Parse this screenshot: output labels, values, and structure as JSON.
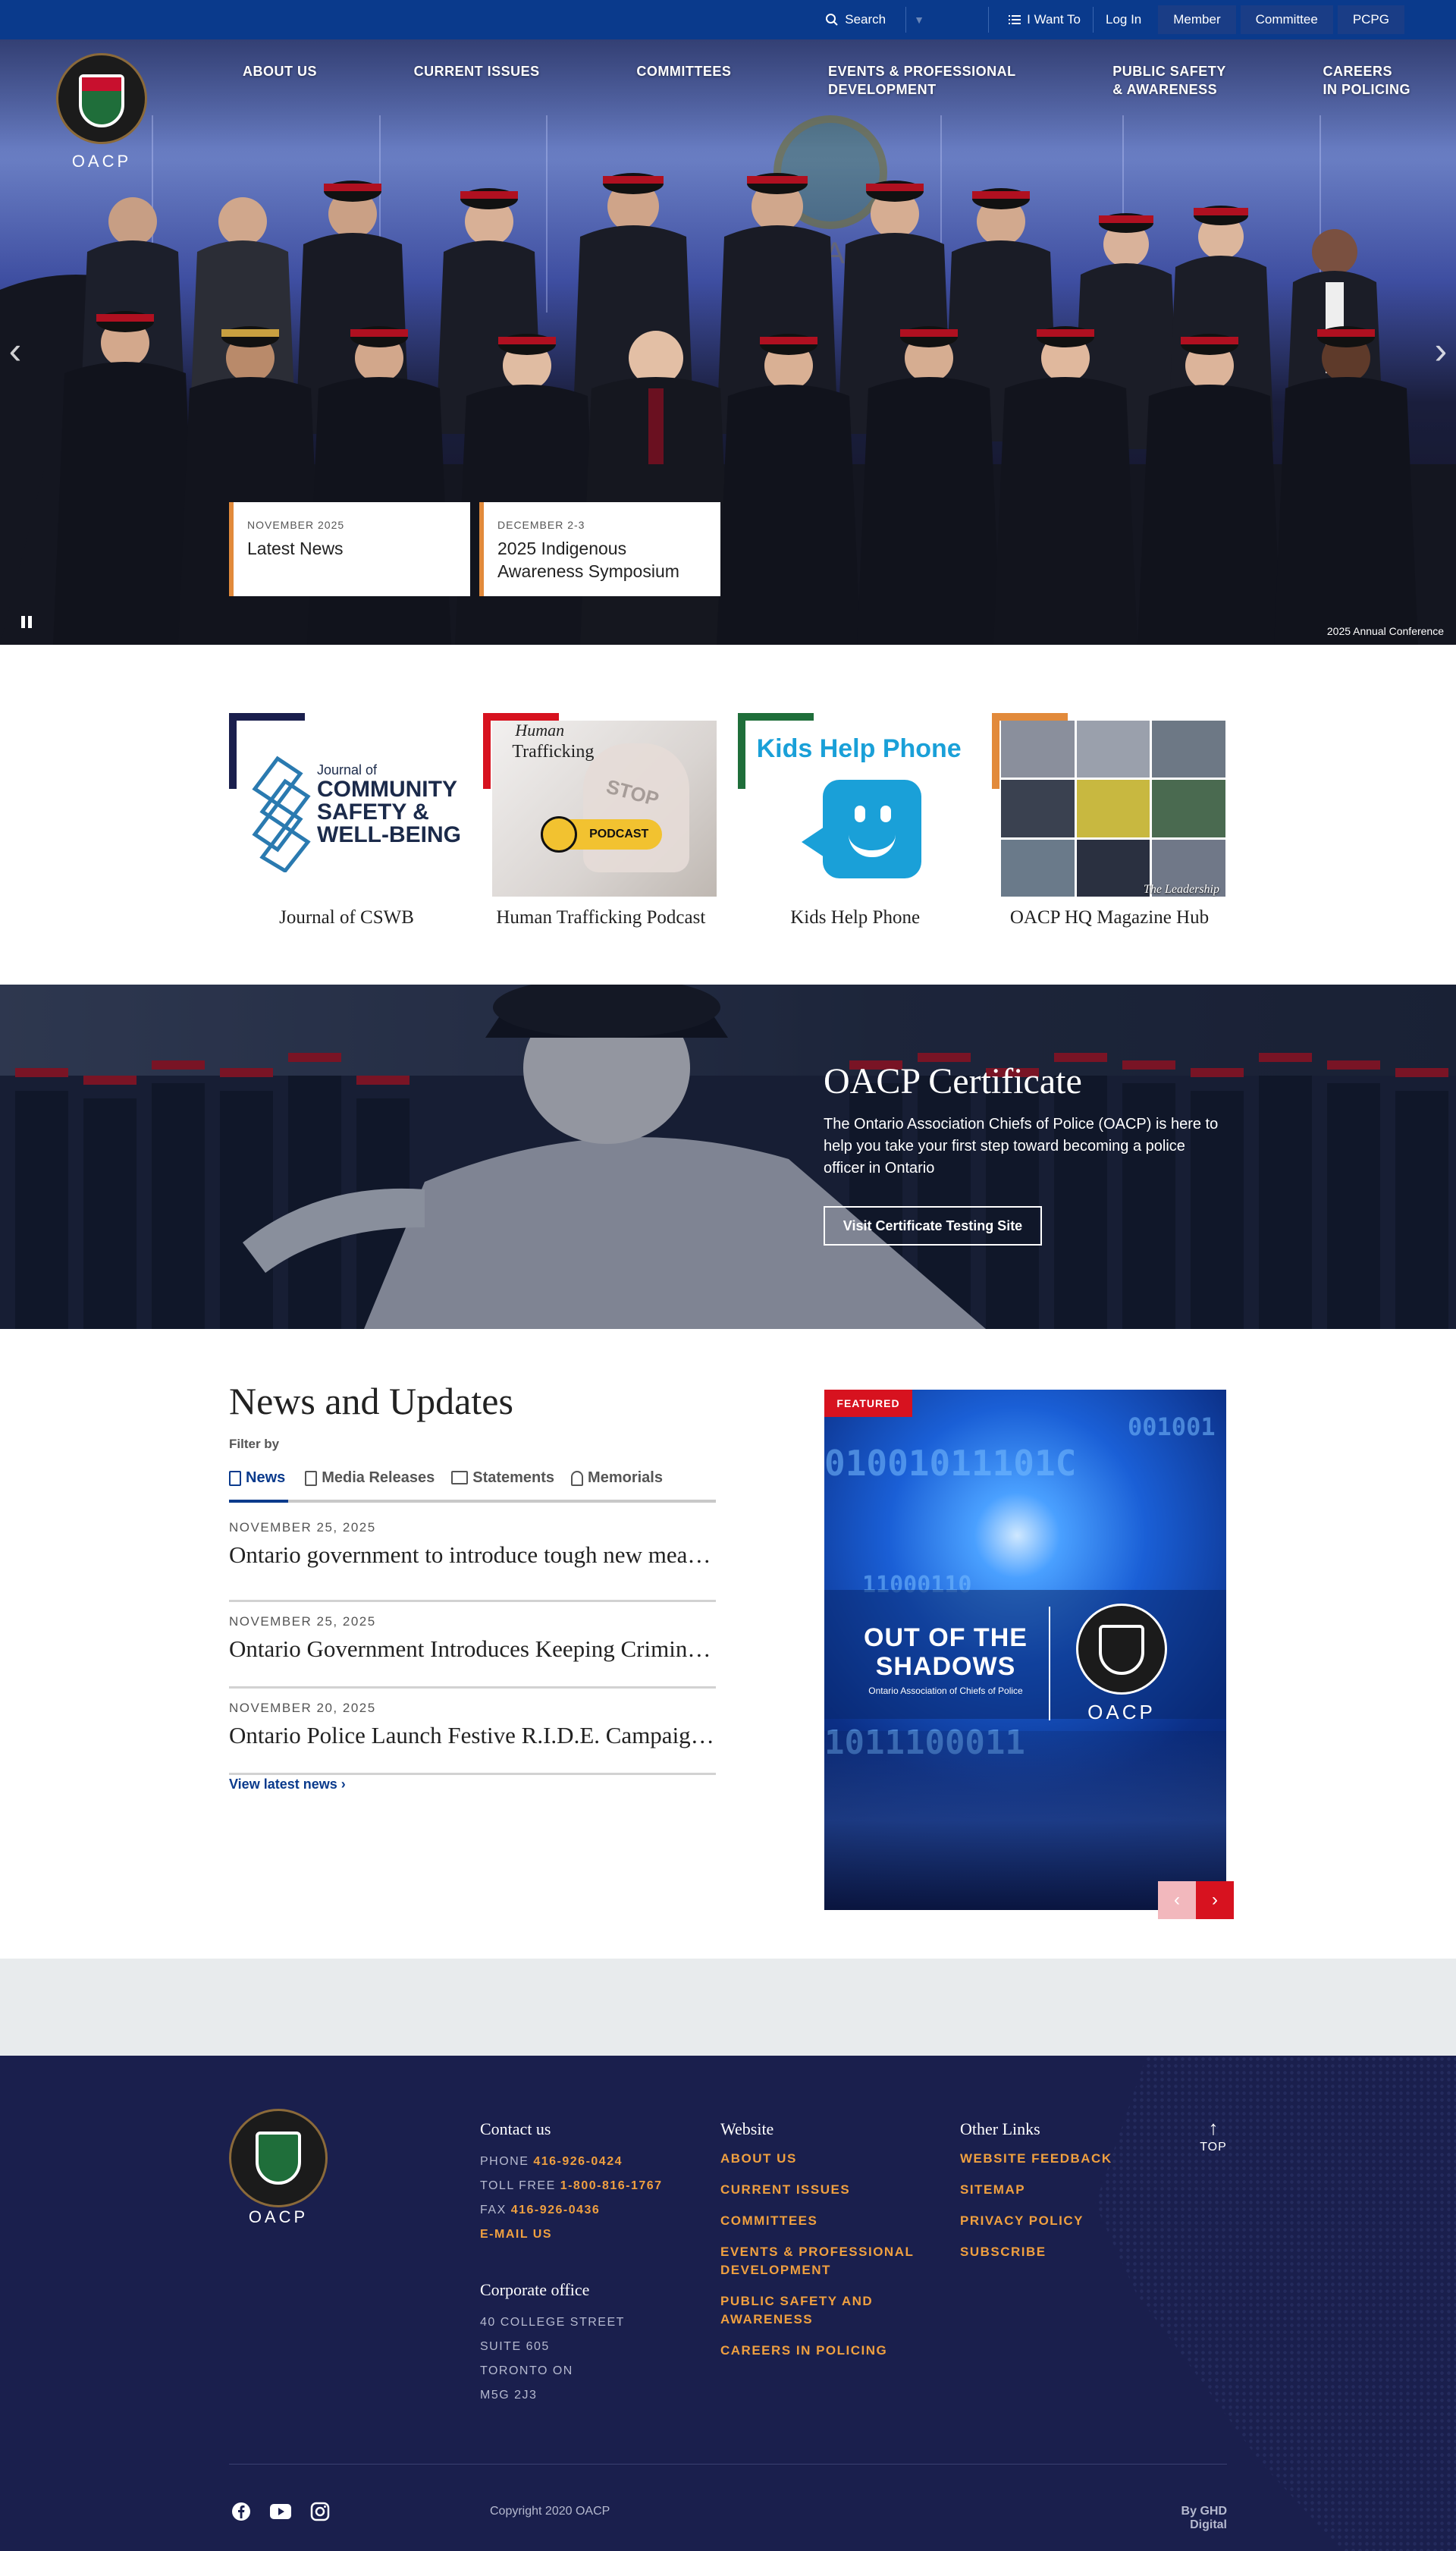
{
  "topbar": {
    "search_label": "Search",
    "language_value": "",
    "i_want_to_label": "I Want To",
    "login_label": "Log In",
    "buttons": [
      "Member",
      "Committee",
      "PCPG"
    ]
  },
  "logo": {
    "text": "OACP"
  },
  "nav": {
    "items": [
      "ABOUT US",
      "CURRENT ISSUES",
      "COMMITTEES",
      "EVENTS & PROFESSIONAL\nDEVELOPMENT",
      "PUBLIC SAFETY\n& AWARENESS",
      "CAREERS\nIN POLICING"
    ]
  },
  "hero": {
    "cards": [
      {
        "date": "NOVEMBER 2025",
        "title": "Latest News"
      },
      {
        "date": "DECEMBER 2-3",
        "title": "2025 Indigenous Awareness Symposium"
      }
    ],
    "caption": "2025 Annual Conference",
    "bg_text": "OACP"
  },
  "tiles": [
    {
      "caption": "Journal of CSWB",
      "accent": "#1a1f4d",
      "line1": "Journal of",
      "line2": "COMMUNITY",
      "line3": "SAFETY &",
      "line4": "WELL-BEING"
    },
    {
      "caption": "Human Trafficking Podcast",
      "accent": "#d7121f",
      "label1": "Human",
      "label2": "Trafficking",
      "pill": "PODCAST",
      "stop": "STOP"
    },
    {
      "caption": "Kids Help Phone",
      "accent": "#1f6e3a",
      "title": "Kids Help Phone"
    },
    {
      "caption": "OACP HQ Magazine Hub",
      "accent": "#e28a3b",
      "cover": "The Leadership"
    }
  ],
  "certificate": {
    "title": "OACP Certificate",
    "body": "The Ontario Association Chiefs of Police (OACP) is here to help you take your first step toward becoming a police officer in Ontario",
    "button": "Visit Certificate Testing Site"
  },
  "news": {
    "title": "News and Updates",
    "filter_label": "Filter by",
    "tabs": [
      "News",
      "Media Releases",
      "Statements",
      "Memorials"
    ],
    "items": [
      {
        "date": "NOVEMBER 25, 2025",
        "title": "Ontario government to introduce tough new measures to protect..."
      },
      {
        "date": "NOVEMBER 25, 2025",
        "title": "Ontario Government Introduces Keeping Criminals Behind Bars..."
      },
      {
        "date": "NOVEMBER 20, 2025",
        "title": "Ontario Police Launch Festive R.I.D.E. Campaign..."
      }
    ],
    "view_latest": "View latest news"
  },
  "featured": {
    "badge": "FEATURED",
    "headline": "OUT OF THE SHADOWS",
    "subline": "Ontario Association of Chiefs of Police",
    "logo_text": "OACP",
    "binary1": "01001011101C",
    "binary2": "001001",
    "binary3": "11000110",
    "binary4": "1011100011"
  },
  "footer": {
    "logo_text": "OACP",
    "contact": {
      "heading": "Contact us",
      "phone_label": "PHONE",
      "phone": "416-926-0424",
      "tollfree_label": "TOLL FREE",
      "tollfree": "1-800-816-1767",
      "fax_label": "FAX",
      "fax": "416-926-0436",
      "email": "E-MAIL US"
    },
    "office": {
      "heading": "Corporate office",
      "lines": [
        "40 COLLEGE STREET",
        "SUITE 605",
        "TORONTO ON",
        "M5G 2J3"
      ]
    },
    "website": {
      "heading": "Website",
      "links": [
        "ABOUT US",
        "CURRENT ISSUES",
        "COMMITTEES",
        "EVENTS & PROFESSIONAL\nDEVELOPMENT",
        "PUBLIC SAFETY AND\nAWARENESS",
        "CAREERS IN POLICING"
      ]
    },
    "other": {
      "heading": "Other Links",
      "links": [
        "WEBSITE FEEDBACK",
        "SITEMAP",
        "PRIVACY POLICY",
        "SUBSCRIBE"
      ]
    },
    "top_label": "TOP",
    "copyright": "Copyright 2020 OACP",
    "credit": "By GHD Digital"
  },
  "colors": {
    "brand_blue": "#0a3a8c",
    "footer_navy": "#1a1f4d",
    "accent_orange": "#f0a040",
    "featured_red": "#d7121f"
  },
  "icons": [
    "search-icon",
    "list-icon",
    "facebook-icon",
    "youtube-icon",
    "instagram-icon",
    "chevron-right-icon",
    "chevron-left-icon",
    "arrow-up-icon",
    "pause-icon"
  ]
}
